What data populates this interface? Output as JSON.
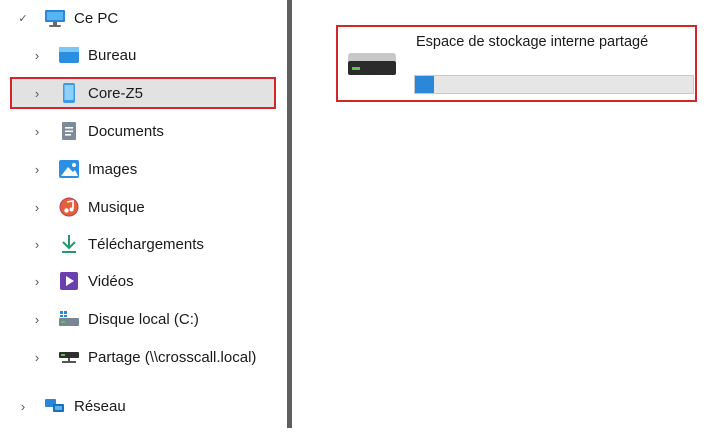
{
  "nav": {
    "this_pc": {
      "label": "Ce PC",
      "icon": "computer-icon",
      "chevron": "expanded"
    },
    "items": [
      {
        "label": "Bureau",
        "icon": "desktop-icon"
      },
      {
        "label": "Core-Z5",
        "icon": "phone-icon",
        "selected": true
      },
      {
        "label": "Documents",
        "icon": "documents-icon"
      },
      {
        "label": "Images",
        "icon": "pictures-icon"
      },
      {
        "label": "Musique",
        "icon": "music-icon"
      },
      {
        "label": "Téléchargements",
        "icon": "download-icon"
      },
      {
        "label": "Vidéos",
        "icon": "videos-icon"
      },
      {
        "label": "Disque local (C:)",
        "icon": "local-disk-icon"
      },
      {
        "label": "Partage (\\\\crosscall.local)",
        "icon": "network-drive-icon"
      }
    ],
    "network": {
      "label": "Réseau",
      "icon": "network-icon"
    }
  },
  "content": {
    "storage": {
      "name": "Espace de stockage interne partagé",
      "icon": "drive-icon",
      "used_fraction": 0.07
    }
  },
  "colors": {
    "highlight_border": "#d2262c",
    "selection_bg": "#e2e2e2",
    "progress_fill": "#2b88d8"
  }
}
